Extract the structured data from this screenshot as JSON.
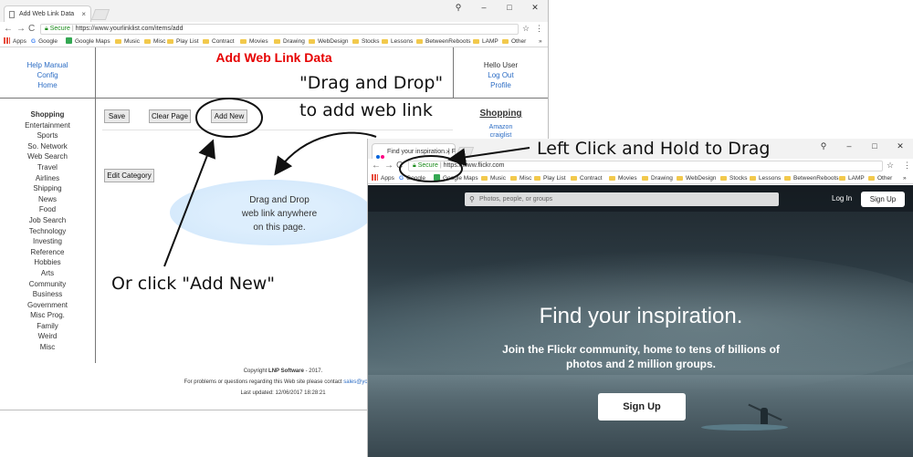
{
  "win1": {
    "tab_title": "Add Web Link Data",
    "tab_close": "×",
    "controls": [
      "⚲",
      "–",
      "□",
      "✕"
    ],
    "nav": {
      "back": "←",
      "forward": "→",
      "reload": "C"
    },
    "address": {
      "secure": "Secure",
      "url": "https://www.yourlinklist.com/items/add"
    },
    "bookmarks": [
      "Apps",
      "Google",
      "Google Maps",
      "Music",
      "Misc",
      "Play List",
      "Contract",
      "Movies",
      "Drawing",
      "WebDesign",
      "Stocks",
      "Lessons",
      "BetweenReboots",
      "LAMP",
      "Other",
      "»"
    ],
    "left_links": [
      "Help Manual",
      "Config",
      "Home"
    ],
    "page_title": "Add Web Link Data",
    "right_header": {
      "greeting": "Hello User",
      "logout": "Log Out",
      "profile": "Profile"
    },
    "categories": [
      "Shopping",
      "Entertainment",
      "Sports",
      "So. Network",
      "Web Search",
      "Travel",
      "Airlines",
      "Shipping",
      "News",
      "Food",
      "Job Search",
      "Technology",
      "Investing",
      "Reference",
      "Hobbies",
      "Arts",
      "Community",
      "Business",
      "Government",
      "Misc Prog.",
      "Family",
      "Weird",
      "Misc"
    ],
    "buttons": {
      "save": "Save",
      "clear": "Clear Page",
      "add_new": "Add New",
      "edit_category": "Edit Category"
    },
    "dropzone": {
      "line1": "Drag and Drop",
      "line2": "web link anywhere",
      "line3": "on this page."
    },
    "right_panel": {
      "heading": "Shopping",
      "link1": "Amazon",
      "link2": "craiglist"
    },
    "footer": {
      "copyright_prefix": "Copyright ",
      "company": "LNP Software",
      "copyright_suffix": " - 2017.",
      "contact": "For problems or questions regarding this Web site please contact ",
      "email": "sales@yourlinkl",
      "updated": "Last updated: 12/06/2017 18:28:21"
    }
  },
  "win2": {
    "tab_title": "Find your inspiration. | F",
    "tab_close": "×",
    "controls": [
      "⚲",
      "–",
      "□",
      "✕"
    ],
    "nav": {
      "back": "←",
      "forward": "→",
      "reload": "C"
    },
    "address": {
      "secure": "Secure",
      "url": "https://www.flickr.com"
    },
    "bookmarks": [
      "Apps",
      "Google",
      "Google Maps",
      "Music",
      "Misc",
      "Play List",
      "Contract",
      "Movies",
      "Drawing",
      "WebDesign",
      "Stocks",
      "Lessons",
      "BetweenReboots",
      "LAMP",
      "Other",
      "»"
    ],
    "search_placeholder": "Photos, people, or groups",
    "login": "Log In",
    "signup_top": "Sign Up",
    "hero": "Find your inspiration.",
    "subline1": "Join the Flickr community, home to tens of billions of",
    "subline2": "photos and 2 million groups.",
    "signup_main": "Sign Up"
  },
  "annotations": {
    "drag_drop_1": "\"Drag and Drop\"",
    "drag_drop_2": "to add web link",
    "left_click": "Left Click and Hold to Drag",
    "or_click": "Or click \"Add New\""
  }
}
